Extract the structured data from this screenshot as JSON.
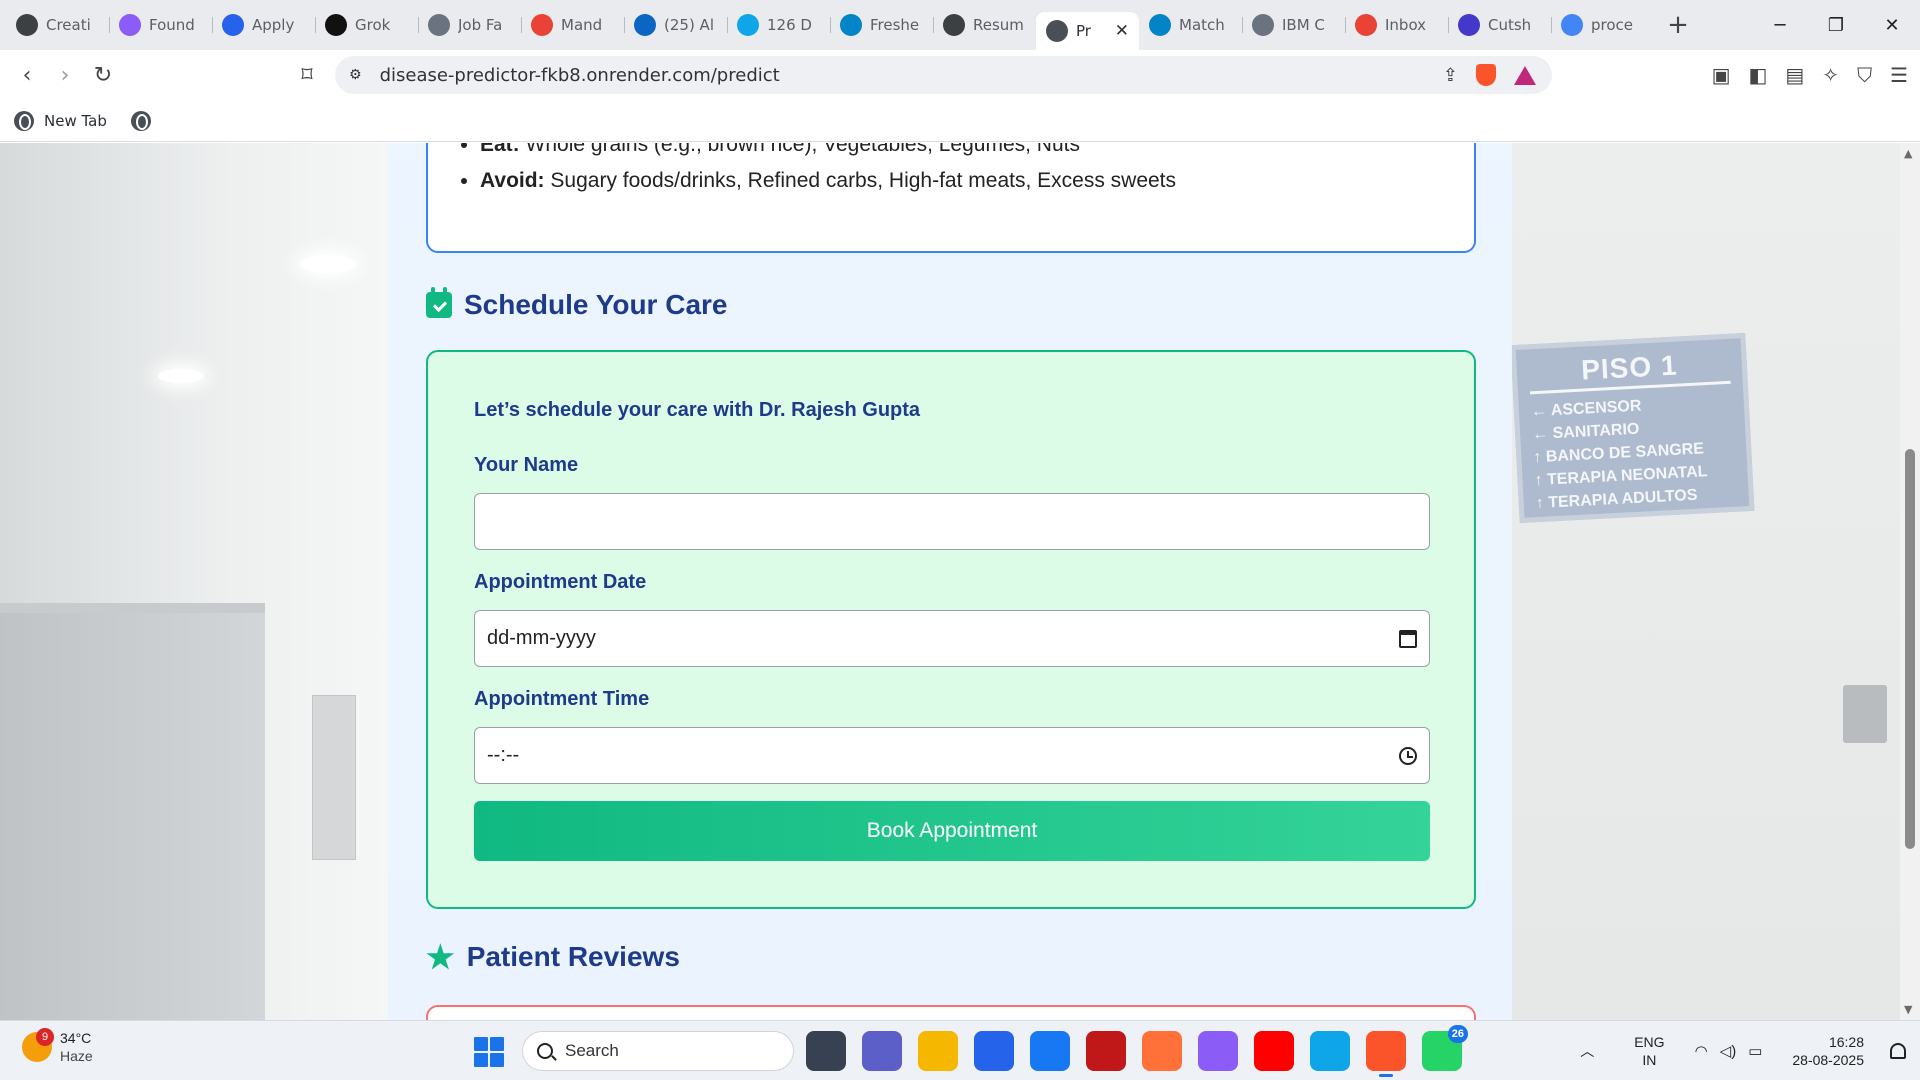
{
  "browser": {
    "tabs": [
      {
        "title": "Creati",
        "icon": "openai-icon",
        "color": "#3c4043"
      },
      {
        "title": "Found",
        "icon": "ai-icon",
        "color": "#8b5cf6"
      },
      {
        "title": "Apply",
        "icon": "k-icon",
        "color": "#2563eb"
      },
      {
        "title": "Grok",
        "icon": "grok-icon",
        "color": "#111111"
      },
      {
        "title": "Job Fa",
        "icon": "job-icon",
        "color": "#6b7280"
      },
      {
        "title": "Mand",
        "icon": "gmail-icon",
        "color": "#ea4335"
      },
      {
        "title": "(25) Al",
        "icon": "linkedin-icon",
        "color": "#0a66c2"
      },
      {
        "title": "126 D",
        "icon": "s-icon",
        "color": "#0ea5e9"
      },
      {
        "title": "Freshe",
        "icon": "is-icon",
        "color": "#0284c7"
      },
      {
        "title": "Resum",
        "icon": "openai-icon",
        "color": "#3c4043"
      },
      {
        "title": "Pr",
        "icon": "globe-icon",
        "color": "#4a4f57",
        "active": true
      },
      {
        "title": "Match",
        "icon": "match-icon",
        "color": "#0284c7"
      },
      {
        "title": "IBM C",
        "icon": "ibm-icon",
        "color": "#6b7280"
      },
      {
        "title": "Inbox",
        "icon": "gmail-icon",
        "color": "#ea4335"
      },
      {
        "title": "Cutsh",
        "icon": "c-icon",
        "color": "#4338ca"
      },
      {
        "title": "proce",
        "icon": "google-icon",
        "color": "#4285f4"
      }
    ],
    "new_tab_symbol": "+",
    "close_tab_symbol": "✕",
    "url": "disease-predictor-fkb8.onrender.com/predict",
    "bookmarks": [
      {
        "label": "New Tab"
      }
    ]
  },
  "page": {
    "top_card": {
      "eat_label": "Eat:",
      "eat_text": "Whole grains (e.g., brown rice), Vegetables, Legumes, Nuts",
      "avoid_label": "Avoid:",
      "avoid_text": "Sugary foods/drinks, Refined carbs, High-fat meats, Excess sweets"
    },
    "schedule": {
      "heading": "Schedule Your Care",
      "intro": "Let’s schedule your care with Dr. Rajesh Gupta",
      "name_label": "Your Name",
      "name_value": "",
      "date_label": "Appointment Date",
      "date_placeholder": "dd-mm-yyyy",
      "time_label": "Appointment Time",
      "time_placeholder": "--:--",
      "button_label": "Book Appointment"
    },
    "reviews": {
      "heading": "Patient Reviews"
    },
    "colors": {
      "heading": "#1e3a8a",
      "accent_green": "#10b981",
      "card_green_bg": "#dcfce7",
      "card_blue_border": "#3b82f6",
      "card_red_border": "#f87171"
    }
  },
  "background_sign": {
    "title": "PISO 1",
    "lines": [
      "← ASCENSOR",
      "← SANITARIO",
      "↑ BANCO DE SANGRE",
      "↑ TERAPIA NEONATAL",
      "↑ TERAPIA ADULTOS"
    ]
  },
  "taskbar": {
    "weather_badge": "9",
    "temperature": "34°C",
    "condition": "Haze",
    "search_placeholder": "Search",
    "apps": [
      {
        "name": "task-view",
        "color": "#374151"
      },
      {
        "name": "teams",
        "color": "#5b5fc7"
      },
      {
        "name": "file-explorer",
        "color": "#f5b700"
      },
      {
        "name": "microsoft-store",
        "color": "#2563eb"
      },
      {
        "name": "facebook",
        "color": "#1877f2"
      },
      {
        "name": "mcafee",
        "color": "#c01818"
      },
      {
        "name": "firefox",
        "color": "#ff7139"
      },
      {
        "name": "copilot",
        "color": "#8b5cf6"
      },
      {
        "name": "youtube",
        "color": "#ff0000"
      },
      {
        "name": "edge-beta",
        "color": "#0ea5e9"
      },
      {
        "name": "brave",
        "color": "#fb542b",
        "active": true
      },
      {
        "name": "whatsapp",
        "color": "#25d366",
        "badge": "26"
      }
    ],
    "lang_line1": "ENG",
    "lang_line2": "IN",
    "time": "16:28",
    "date": "28-08-2025"
  }
}
